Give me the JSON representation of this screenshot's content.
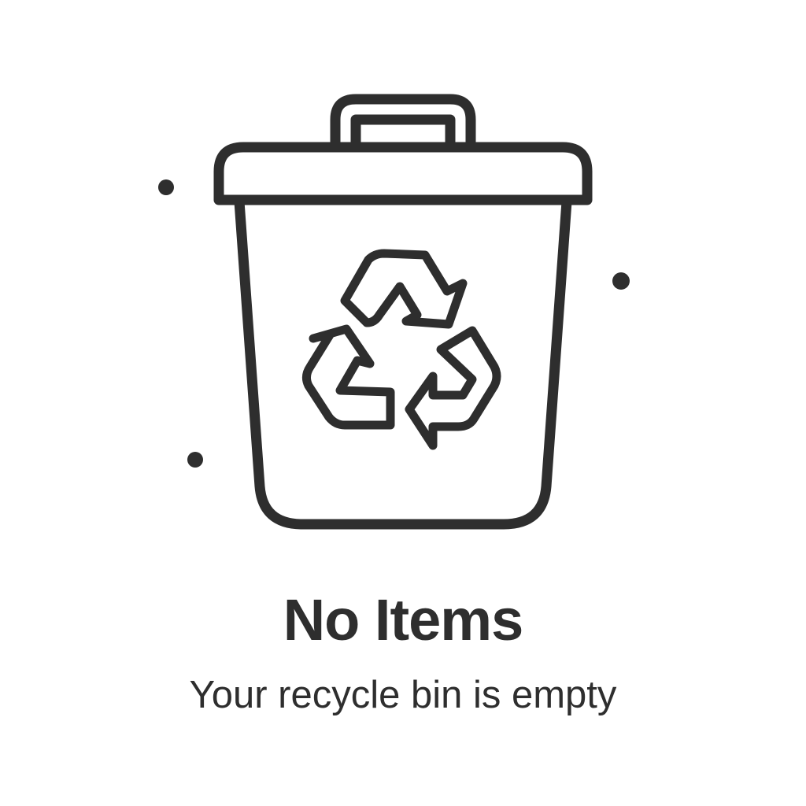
{
  "empty_state": {
    "title": "No Items",
    "message": "Your recycle bin is empty",
    "illustration_icon": "recycle-bin-icon",
    "symbol_icon": "recycle-symbol-icon"
  },
  "colors": {
    "stroke": "#2e2e2e",
    "background": "#ffffff",
    "text": "#2e2e2e"
  }
}
